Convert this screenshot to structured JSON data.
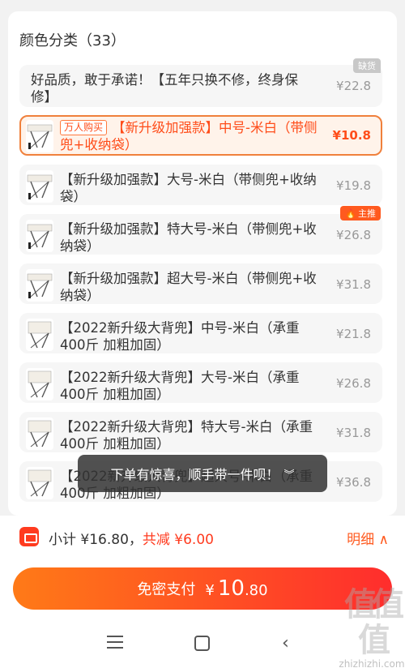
{
  "section_title": "颜色分类（33）",
  "options": [
    {
      "text": "好品质，敢于承诺！【五年只换不修，终身保修】",
      "price": "¥22.8",
      "badge": "缺货"
    },
    {
      "tag": "万人购买",
      "text": "【新升级加强款】中号-米白（带侧兜+收纳袋）",
      "price": "¥10.8",
      "selected": true
    },
    {
      "text": "【新升级加强款】大号-米白（带侧兜+收纳袋）",
      "price": "¥19.8"
    },
    {
      "text": "【新升级加强款】特大号-米白（带侧兜+收纳袋）",
      "price": "¥26.8",
      "badge": "主推"
    },
    {
      "text": "【新升级加强款】超大号-米白（带侧兜+收纳袋）",
      "price": "¥31.8"
    },
    {
      "text": "【2022新升级大背兜】中号-米白（承重400斤 加粗加固）",
      "price": "¥21.8"
    },
    {
      "text": "【2022新升级大背兜】大号-米白（承重400斤 加粗加固）",
      "price": "¥26.8"
    },
    {
      "text": "【2022新升级大背兜】特大号-米白（承重400斤 加粗加固）",
      "price": "¥31.8"
    },
    {
      "text": "【2022新升级大背兜】超大号-米白（承重400斤 加粗加固）",
      "price": "¥36.8"
    }
  ],
  "toast": {
    "text": "下单有惊喜，顺手带一件呗！",
    "icon": "double-chevron-down-icon"
  },
  "summary": {
    "subtotal_label": "小计 ¥16.80，",
    "discount_label": "共减 ¥6.00",
    "detail_label": "明细"
  },
  "pay": {
    "label": "免密支付",
    "currency": "¥",
    "amount_int": "10",
    "amount_dec": ".80"
  },
  "watermark": {
    "glyphs": "值值值",
    "text": "zhizhizhi.com"
  },
  "colors": {
    "accent": "#ff4d1a",
    "pay_start": "#ff7a17",
    "pay_end": "#ff2d2d",
    "selected_border": "#f0803c"
  }
}
